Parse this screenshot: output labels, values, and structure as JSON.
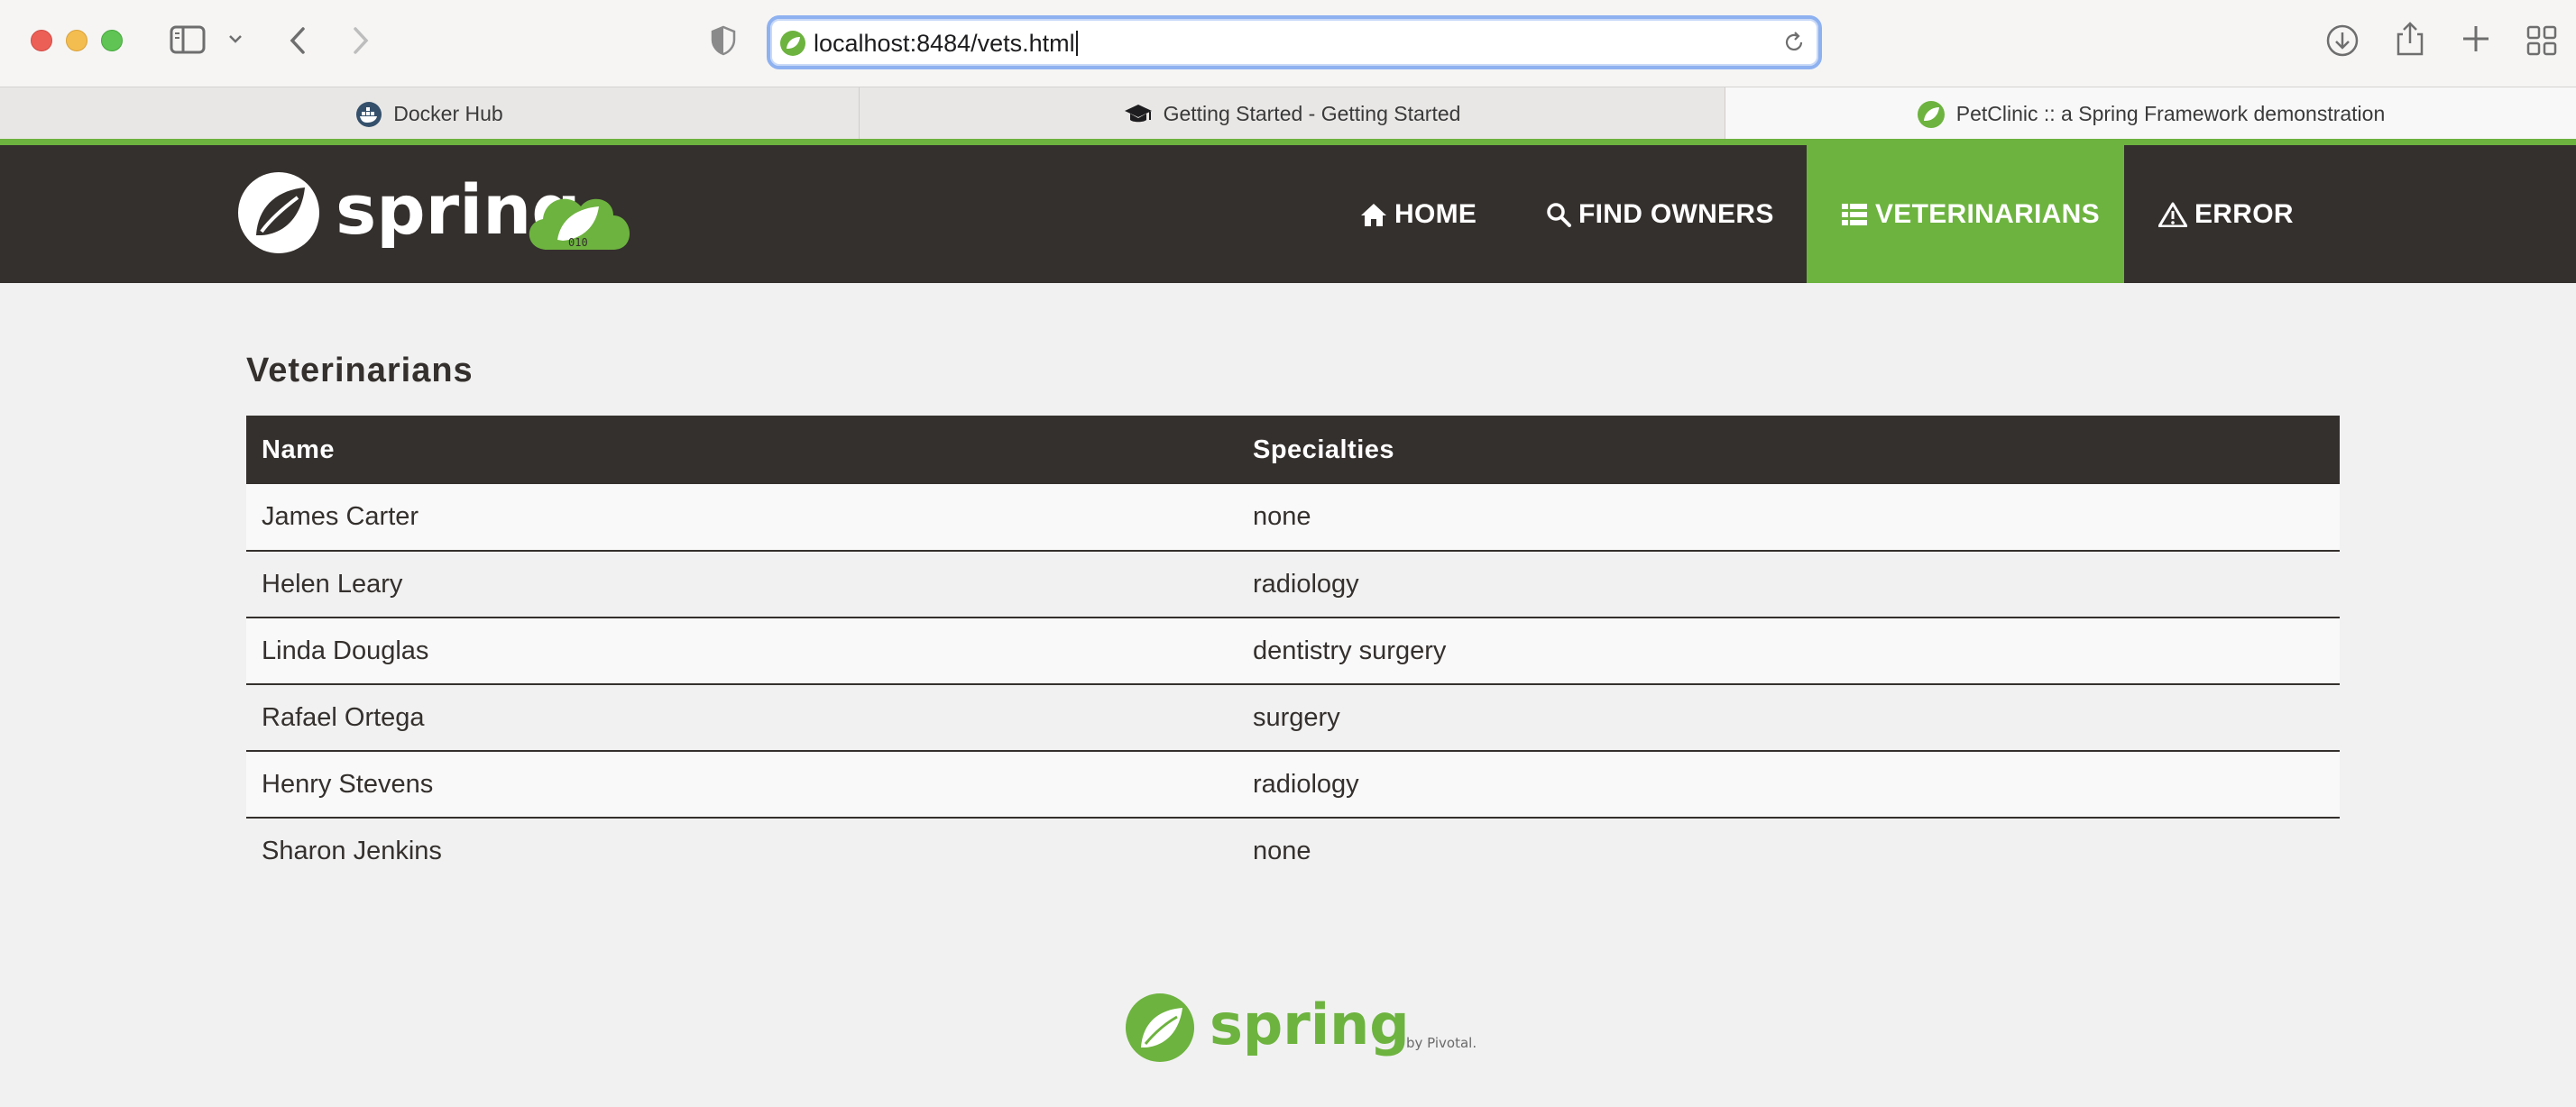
{
  "browser": {
    "url": "localhost:8484/vets.html",
    "tabs": [
      {
        "label": "Docker Hub",
        "icon": "docker-icon"
      },
      {
        "label": "Getting Started - Getting Started",
        "icon": "graduation-cap-icon"
      },
      {
        "label": "PetClinic :: a Spring Framework demonstration",
        "icon": "spring-leaf-icon",
        "active": true
      }
    ]
  },
  "navbar": {
    "brand": "spring",
    "items": [
      {
        "label": "HOME",
        "icon": "home-icon"
      },
      {
        "label": "FIND OWNERS",
        "icon": "search-icon"
      },
      {
        "label": "VETERINARIANS",
        "icon": "list-icon",
        "active": true
      },
      {
        "label": "ERROR",
        "icon": "warning-icon"
      }
    ]
  },
  "page": {
    "title": "Veterinarians",
    "columns": [
      "Name",
      "Specialties"
    ],
    "rows": [
      {
        "name": "James Carter",
        "specialties": "none"
      },
      {
        "name": "Helen Leary",
        "specialties": "radiology"
      },
      {
        "name": "Linda Douglas",
        "specialties": "dentistry surgery"
      },
      {
        "name": "Rafael Ortega",
        "specialties": "surgery"
      },
      {
        "name": "Henry Stevens",
        "specialties": "radiology"
      },
      {
        "name": "Sharon Jenkins",
        "specialties": "none"
      }
    ]
  },
  "footer": {
    "brand": "spring",
    "byline": "by Pivotal."
  },
  "colors": {
    "accent": "#6db33f",
    "dark": "#34302d"
  }
}
